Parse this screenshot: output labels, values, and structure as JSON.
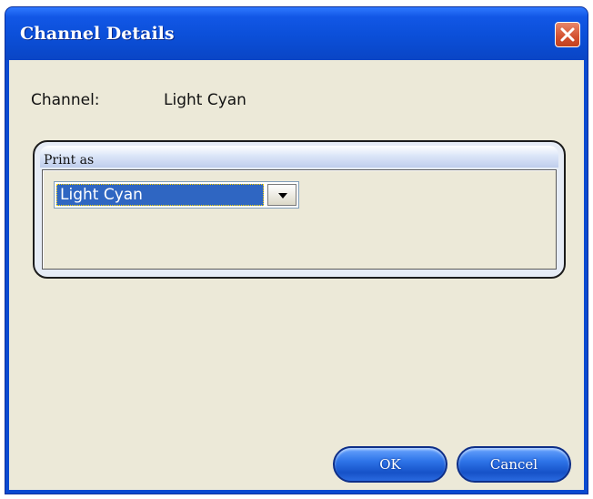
{
  "window": {
    "title": "Channel Details",
    "close_icon": "close-icon",
    "close_color": "#d3502f",
    "titlebar_color": "#0b4fd8"
  },
  "channel": {
    "label": "Channel:",
    "value": "Light Cyan"
  },
  "print_as": {
    "group_title": "Print as",
    "selected_value": "Light Cyan",
    "dropdown_icon": "chevron-down-icon",
    "selection_color": "#2f66c2"
  },
  "buttons": {
    "ok_label": "OK",
    "cancel_label": "Cancel"
  }
}
